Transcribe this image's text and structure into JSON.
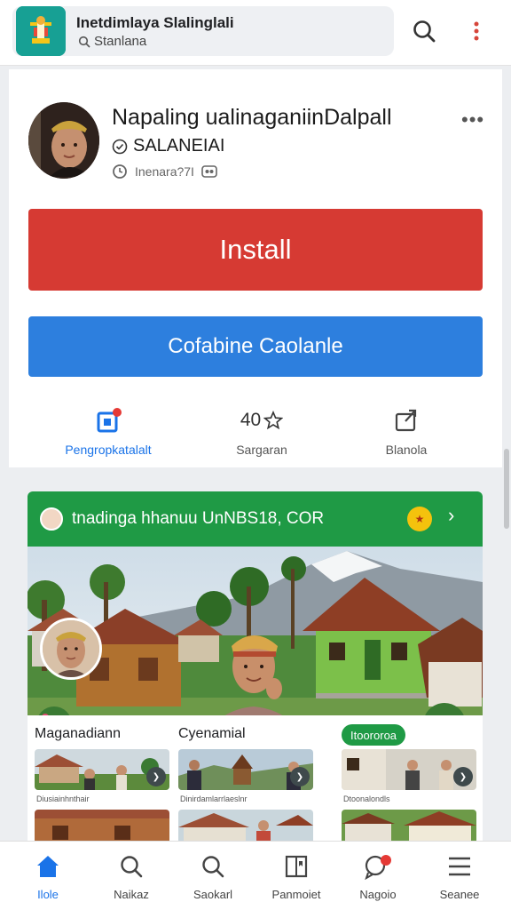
{
  "topbar": {
    "app_title": "Inetdimlaya Slalinglali",
    "app_subtitle": "Stanlana",
    "search_icon": "search-icon",
    "more_icon": "more-vertical-icon"
  },
  "app": {
    "name": "Napaling ualinaganiinDalpall",
    "developer": "SALANEIAI",
    "meta_text": "Inenara?7I",
    "install_label": "Install",
    "secondary_label": "Cofabine Caolanle",
    "stats": [
      {
        "label": "Pengropkatalalt",
        "icon": "gift-icon"
      },
      {
        "value": "40",
        "label": "Sargaran",
        "icon": "star-icon"
      },
      {
        "label": "Blanola",
        "icon": "share-icon"
      }
    ]
  },
  "feature": {
    "header_title": "tnadinga hhanuu UnNBS18, COR",
    "gallery_left_title": "Maganadiann",
    "gallery_mid_title": "Cyenamial",
    "gallery_chip": "Itoororoa",
    "thumb_captions": [
      "Diusiainhnthair",
      "Dinirdamlarrlaeslnr",
      "Dtoonalondls"
    ]
  },
  "bottom_nav": [
    {
      "label": "Ilole",
      "icon": "home-icon",
      "active": true
    },
    {
      "label": "Naikaz",
      "icon": "search-icon",
      "active": false
    },
    {
      "label": "Saokarl",
      "icon": "search-icon",
      "active": false
    },
    {
      "label": "Panmoiet",
      "icon": "book-icon",
      "active": false
    },
    {
      "label": "Nagoio",
      "icon": "chat-icon",
      "active": false
    },
    {
      "label": "Seanee",
      "icon": "menu-icon",
      "active": false
    }
  ],
  "colors": {
    "install": "#d63a33",
    "secondary": "#2d7fde",
    "feature_header": "#1f9a45",
    "nav_active": "#1a73e8"
  }
}
